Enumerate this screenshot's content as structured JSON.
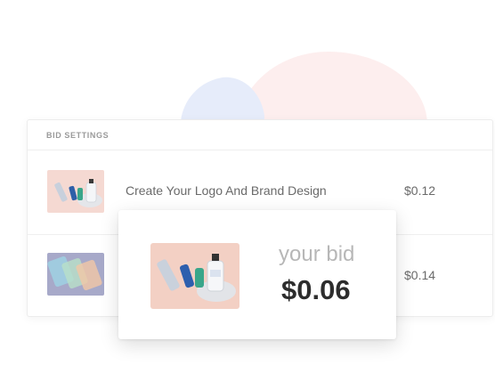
{
  "bid_settings": {
    "header_label": "BID SETTINGS",
    "rows": [
      {
        "title": "Create Your Logo And Brand Design",
        "price": "$0.12"
      },
      {
        "title": "",
        "price": "$0.14"
      }
    ]
  },
  "bid_card": {
    "label": "your bid",
    "amount": "$0.06"
  },
  "colors": {
    "blob_pink": "#fdeeee",
    "blob_blue": "#e6ecfa",
    "text_dark": "#2d2d2d",
    "text_muted": "#b7b7b7"
  }
}
